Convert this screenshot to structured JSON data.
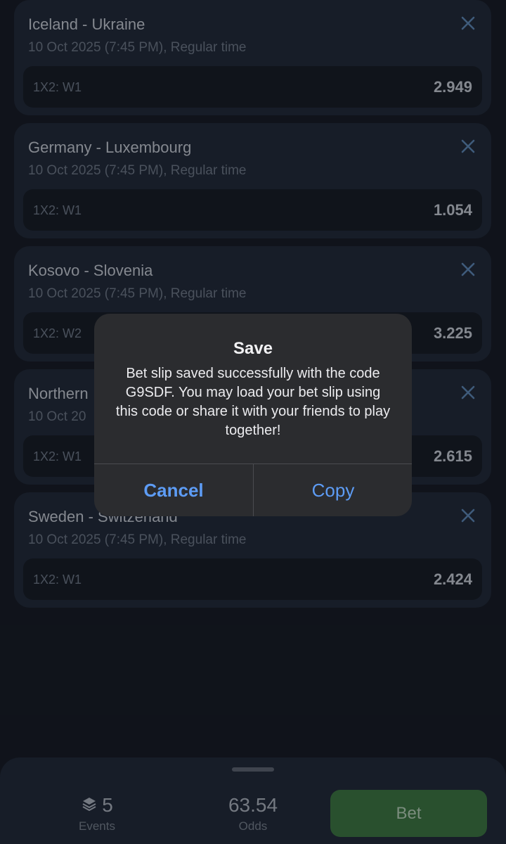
{
  "bets": [
    {
      "match": "Iceland - Ukraine",
      "time": "10 Oct 2025 (7:45 PM), Regular time",
      "market": "1X2: W1",
      "odds": "2.949"
    },
    {
      "match": "Germany - Luxembourg",
      "time": "10 Oct 2025 (7:45 PM), Regular time",
      "market": "1X2: W1",
      "odds": "1.054"
    },
    {
      "match": "Kosovo - Slovenia",
      "time": "10 Oct 2025 (7:45 PM), Regular time",
      "market": "1X2: W2",
      "odds": "3.225"
    },
    {
      "match": "Northern",
      "time": "10 Oct 20",
      "market": "1X2: W1",
      "odds": "2.615"
    },
    {
      "match": "Sweden - Switzerland",
      "time": "10 Oct 2025 (7:45 PM), Regular time",
      "market": "1X2: W1",
      "odds": "2.424"
    }
  ],
  "icons": {
    "remove": "close-icon",
    "events": "layers-icon"
  },
  "summary": {
    "events_count": "5",
    "events_label": "Events",
    "odds_value": "63.54",
    "odds_label": "Odds",
    "bet_label": "Bet"
  },
  "alert": {
    "title": "Save",
    "message": "Bet slip saved successfully with the code G9SDF. You may load your bet slip using this code or share it with your friends to play together!",
    "cancel_label": "Cancel",
    "copy_label": "Copy"
  },
  "colors": {
    "background": "#141a22",
    "card": "#1f2836",
    "accent_blue": "#5d9cf5",
    "bet_green": "#3b7740"
  }
}
